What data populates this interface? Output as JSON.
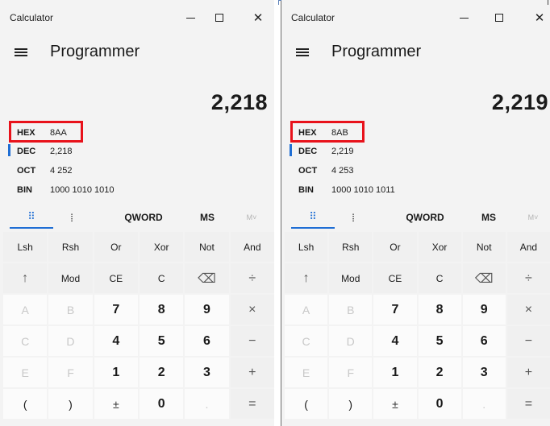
{
  "left": {
    "app_title": "Calculator",
    "window_buttons": {
      "close": "✕"
    },
    "mode": "Programmer",
    "display": "2,218",
    "radix": [
      {
        "name": "HEX",
        "value": "8AA"
      },
      {
        "name": "DEC",
        "value": "2,218"
      },
      {
        "name": "OCT",
        "value": "4 252"
      },
      {
        "name": "BIN",
        "value": "1000 1010 1010"
      }
    ],
    "tabs": {
      "keypad_icon": "⠿",
      "bits_icon": "⁞",
      "word": "QWORD",
      "ms": "MS",
      "mv": "M˅"
    },
    "keys": [
      "Lsh",
      "Rsh",
      "Or",
      "Xor",
      "Not",
      "And",
      "↑",
      "Mod",
      "CE",
      "C",
      "⌫",
      "÷",
      "A",
      "B",
      "7",
      "8",
      "9",
      "×",
      "C",
      "D",
      "4",
      "5",
      "6",
      "−",
      "E",
      "F",
      "1",
      "2",
      "3",
      "+",
      "(",
      ")",
      "±",
      "0",
      ".",
      "="
    ]
  },
  "right": {
    "app_title": "Calculator",
    "window_buttons": {
      "close": "✕"
    },
    "mode": "Programmer",
    "display": "2,219",
    "radix": [
      {
        "name": "HEX",
        "value": "8AB"
      },
      {
        "name": "DEC",
        "value": "2,219"
      },
      {
        "name": "OCT",
        "value": "4 253"
      },
      {
        "name": "BIN",
        "value": "1000 1010 1011"
      }
    ],
    "tabs": {
      "keypad_icon": "⠿",
      "bits_icon": "⁞",
      "word": "QWORD",
      "ms": "MS",
      "mv": "M˅"
    },
    "keys": [
      "Lsh",
      "Rsh",
      "Or",
      "Xor",
      "Not",
      "And",
      "↑",
      "Mod",
      "CE",
      "C",
      "⌫",
      "÷",
      "A",
      "B",
      "7",
      "8",
      "9",
      "×",
      "C",
      "D",
      "4",
      "5",
      "6",
      "−",
      "E",
      "F",
      "1",
      "2",
      "3",
      "+",
      "(",
      ")",
      "±",
      "0",
      ".",
      "="
    ]
  },
  "colors": {
    "accent": "#1f6ed4",
    "highlight": "#e8121b",
    "panel_bg": "#f3f3f3"
  }
}
